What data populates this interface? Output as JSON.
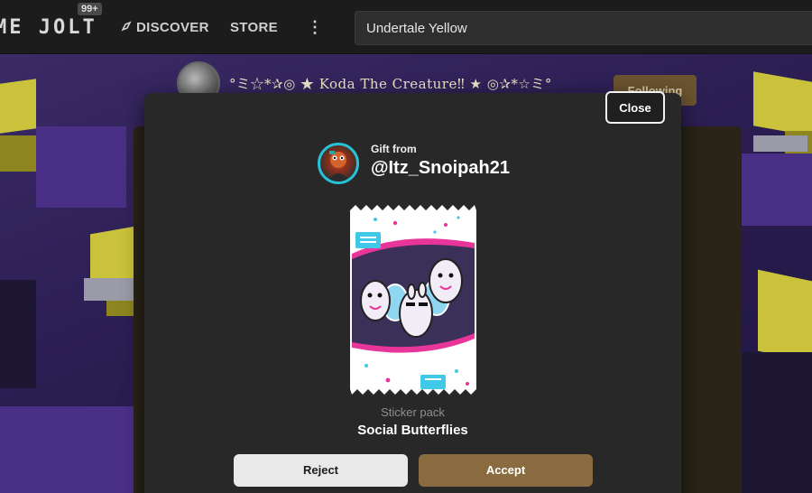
{
  "topbar": {
    "logo_text": "ME JOLT",
    "notification_count": "99+",
    "nav": {
      "discover_label": "DISCOVER",
      "store_label": "STORE",
      "more_icon": "vertical-ellipsis-icon"
    },
    "search_value": "Undertale Yellow"
  },
  "background": {
    "profile_name": "°ミ☆*✰◎ ★ Koda The Creature‼ ★ ◎✰*☆ミ°",
    "following_label": "Following"
  },
  "modal": {
    "close_label": "Close",
    "gift_from_label": "Gift from",
    "sender_name": "@Itz_Snoipah21",
    "pack_type": "Sticker pack",
    "pack_name": "Social Butterflies",
    "reject_label": "Reject",
    "accept_label": "Accept"
  },
  "colors": {
    "accept": "#8a6b3f",
    "reject": "#e9e9e9",
    "modal_bg": "#282828",
    "avatar_ring": "#27c2d6",
    "pack_pink": "#e8359a",
    "pack_cyan": "#3fc8e8"
  }
}
